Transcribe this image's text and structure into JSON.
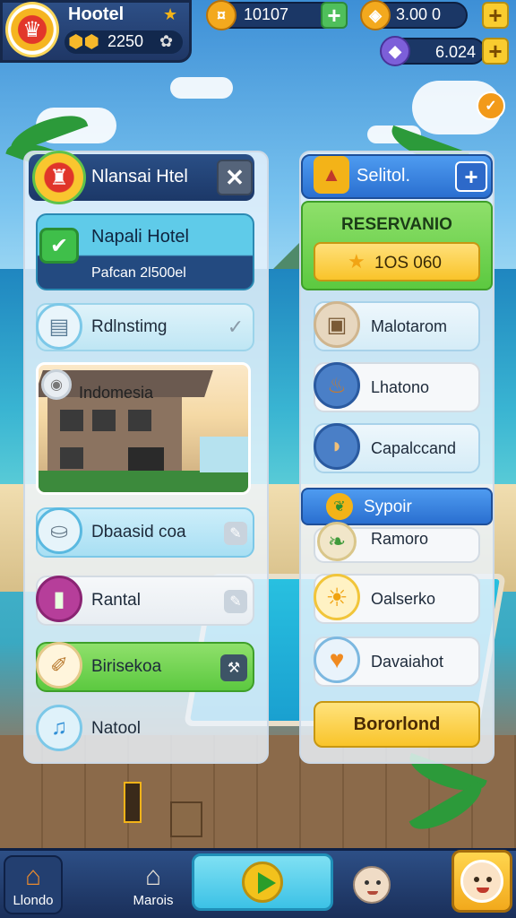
{
  "hud": {
    "title": "Hootel",
    "coins": "2250",
    "resources": [
      {
        "icon": "coin-icon",
        "value": "10107"
      },
      {
        "icon": "shield-icon",
        "value": "3.00   0"
      },
      {
        "icon": "gem-icon",
        "value": "6.024"
      }
    ]
  },
  "left_panel": {
    "header_title": "Nlansai Htel",
    "selected": {
      "title": "Napali Hotel",
      "subtitle": "Pafcan 2l500el"
    },
    "amenity": "Rdlnstimg",
    "preview_label": "Indomesia",
    "items": [
      "Dbaasid coa",
      "Rantal",
      "Birisekoa",
      "Natool"
    ]
  },
  "right_panel": {
    "header_title": "Selitol.",
    "reservation": {
      "title": "RESERVANIO",
      "price": "1OS 060"
    },
    "items": [
      "Malotarom",
      "Lhatono",
      "Capalccand"
    ],
    "section_title": "Sypoir",
    "section_items": [
      "Ramoro",
      "Oalserko",
      "Davaiahot"
    ],
    "confirm_button": "Bororlond"
  },
  "bottom_nav": {
    "home": "Llondo",
    "market": "Marois"
  },
  "colors": {
    "accent_green": "#5cc940",
    "accent_yellow": "#f9cc2f",
    "accent_blue": "#3b7fe0",
    "dark_navy": "#1f3766"
  }
}
